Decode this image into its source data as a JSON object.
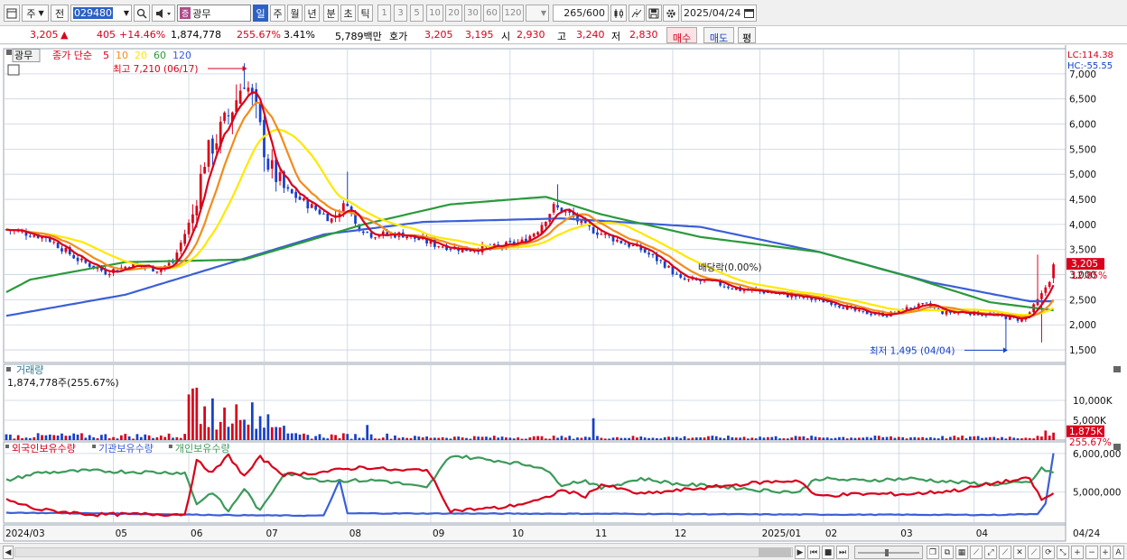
{
  "toolbar": {
    "type1": "주",
    "type2": "전",
    "code": "029480",
    "stock_name": "광무",
    "periods": [
      "일",
      "주",
      "월",
      "년",
      "분",
      "초",
      "틱"
    ],
    "active_period": "일",
    "intervals": [
      "1",
      "3",
      "5",
      "10",
      "20",
      "30",
      "60",
      "120"
    ],
    "count": "265",
    "count_max": "600",
    "date": "2025/04/24",
    "icon_names": [
      "window-icon",
      "dropdown-icon",
      "search-icon",
      "speaker-icon",
      "candle-type-icon",
      "crosshair-icon",
      "save-icon",
      "settings-icon",
      "calendar-icon"
    ]
  },
  "quote": {
    "price": "3,205",
    "change": "405",
    "change_pct": "+14.46%",
    "volume": "1,874,778",
    "volume_ratio": "255.67%",
    "turnover": "3.41%",
    "amount": "5,789백만",
    "ask_label": "호가",
    "ask": "3,205",
    "bid": "3,195",
    "open_label": "시",
    "open": "2,930",
    "high_label": "고",
    "high": "3,240",
    "low_label": "저",
    "low": "2,830",
    "buy_label": "매수",
    "sell_label": "매도",
    "eval_label": "평",
    "up_symbol": "▲"
  },
  "colors": {
    "up": "#d9001b",
    "down": "#1640c8",
    "ma5": "#d9001b",
    "ma10": "#f28c1c",
    "ma20": "#ffe800",
    "ma60": "#2a9a3a",
    "ma120": "#3a5fd8",
    "foreign": "#d9001b",
    "institution": "#3a5fd8",
    "individual": "#3c9a5a",
    "grid": "#c8d2e0"
  },
  "chart_data": [
    {
      "type": "candlestick",
      "panel": "price",
      "header": {
        "name": "광무",
        "ma_title": "종가 단순",
        "ma_periods": [
          "5",
          "10",
          "20",
          "60",
          "120"
        ]
      },
      "right_labels": {
        "lc": "LC:114.38",
        "hc": "HC:-55.55",
        "last_price": "3,205",
        "last_pct": "12.85%"
      },
      "y_ticks": [
        "7,000",
        "6,500",
        "6,000",
        "5,500",
        "5,000",
        "4,500",
        "4,000",
        "3,500",
        "3,000",
        "2,500",
        "2,000",
        "1,500"
      ],
      "ylim": [
        1250,
        7500
      ],
      "annotations": {
        "high": "최고 7,210 (06/17)",
        "low": "최저 1,495 (04/04)",
        "dividend": "배당락(0.00%)"
      },
      "x_labels": [
        "2024/03",
        "05",
        "06",
        "07",
        "08",
        "09",
        "10",
        "11",
        "12",
        "2025/01",
        "02",
        "03",
        "04",
        "04/24"
      ],
      "closes_monthly_anchor": [
        [
          "2024/03",
          3900
        ],
        [
          "2024/04",
          3050
        ],
        [
          "2024/05",
          3150
        ],
        [
          "2024/05b",
          5200
        ],
        [
          "2024/06",
          6950
        ],
        [
          "2024/06b",
          4650
        ],
        [
          "2024/07",
          4150
        ],
        [
          "2024/07b",
          3850
        ],
        [
          "2024/08",
          3700
        ],
        [
          "2024/09",
          3600
        ],
        [
          "2024/10",
          4350
        ],
        [
          "2024/10b",
          3600
        ],
        [
          "2024/11",
          2900
        ],
        [
          "2024/12",
          2650
        ],
        [
          "2025/01",
          2500
        ],
        [
          "2025/02",
          2150
        ],
        [
          "2025/02b",
          2350
        ],
        [
          "2025/03",
          2250
        ],
        [
          "2025/04",
          2050
        ],
        [
          "2025/04/24",
          3205
        ]
      ],
      "ma60_anchor": [
        [
          0,
          2650
        ],
        [
          6,
          2900
        ],
        [
          30,
          3250
        ],
        [
          60,
          3300
        ],
        [
          90,
          4000
        ],
        [
          112,
          4400
        ],
        [
          136,
          4550
        ],
        [
          150,
          4200
        ],
        [
          175,
          3750
        ],
        [
          205,
          3450
        ],
        [
          228,
          2950
        ],
        [
          248,
          2450
        ],
        [
          265,
          2280
        ]
      ],
      "ma120_anchor": [
        [
          0,
          2180
        ],
        [
          30,
          2600
        ],
        [
          55,
          3200
        ],
        [
          80,
          3800
        ],
        [
          105,
          4050
        ],
        [
          140,
          4120
        ],
        [
          175,
          3950
        ],
        [
          205,
          3450
        ],
        [
          233,
          2850
        ],
        [
          258,
          2470
        ],
        [
          265,
          2470
        ]
      ]
    },
    {
      "type": "bar",
      "panel": "volume",
      "title": "거래량",
      "value_label": "1,874,778주(255.67%)",
      "y_ticks": [
        "10,000K",
        "5,000K"
      ],
      "ylim": [
        0,
        15000
      ],
      "unit": "K",
      "last_label": "1,875K",
      "last_pct": "255.67%",
      "spikes": [
        [
          46,
          11500
        ],
        [
          47,
          13000
        ],
        [
          48,
          13200
        ],
        [
          50,
          8500
        ],
        [
          52,
          10500
        ],
        [
          55,
          8200
        ],
        [
          58,
          9000
        ],
        [
          62,
          9500
        ],
        [
          66,
          6500
        ],
        [
          91,
          3800
        ],
        [
          148,
          5500
        ],
        [
          262,
          2400
        ],
        [
          264,
          1875
        ]
      ],
      "base_volume_k": 900
    },
    {
      "type": "line",
      "panel": "holdings",
      "series_names": [
        "외국인보유수량",
        "기관보유수량",
        "개인보유수량"
      ],
      "y_ticks": [
        "6,000,000",
        "5,000,000"
      ],
      "ylim": [
        4200000,
        6300000
      ]
    }
  ]
}
